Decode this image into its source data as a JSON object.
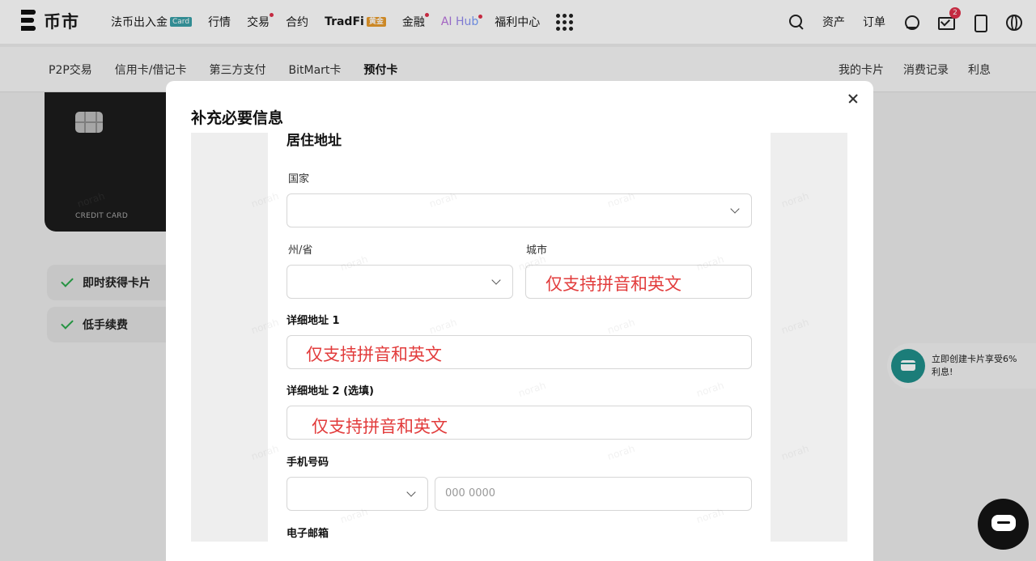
{
  "brand": {
    "name": "币市"
  },
  "topnav": {
    "items": [
      {
        "label": "法币出入金",
        "tag": "Card"
      },
      {
        "label": "行情"
      },
      {
        "label": "交易"
      },
      {
        "label": "合约"
      },
      {
        "label": "TradFi",
        "tag": "黄金"
      },
      {
        "label": "金融"
      },
      {
        "label": "AI Hub"
      },
      {
        "label": "福利中心"
      }
    ],
    "assets": "资产",
    "orders": "订单",
    "mail_badge": "2"
  },
  "subnav": {
    "left": [
      "P2P交易",
      "信用卡/借记卡",
      "第三方支付",
      "BitMart卡",
      "预付卡"
    ],
    "right": [
      "我的卡片",
      "消费记录",
      "利息"
    ]
  },
  "card": {
    "label": "CREDIT CARD"
  },
  "features": [
    "即时获得卡片",
    "低手续费"
  ],
  "promo": {
    "text": "立即创建卡片享受6% 利息!"
  },
  "watermark": "norah",
  "modal": {
    "title": "补充必要信息",
    "section_title": "居住地址",
    "country_label": "国家",
    "state_label": "州/省",
    "city_label": "城市",
    "address1_label": "详细地址 1",
    "address2_label": "详细地址 2 (选填)",
    "phone_label": "手机号码",
    "phone_placeholder": "000 0000",
    "email_label": "电子邮箱",
    "annotation": "仅支持拼音和英文"
  },
  "colors": {
    "annotation": "#e23c3c",
    "check": "#2aa84a",
    "promo_icon": "#1f8f8a"
  }
}
